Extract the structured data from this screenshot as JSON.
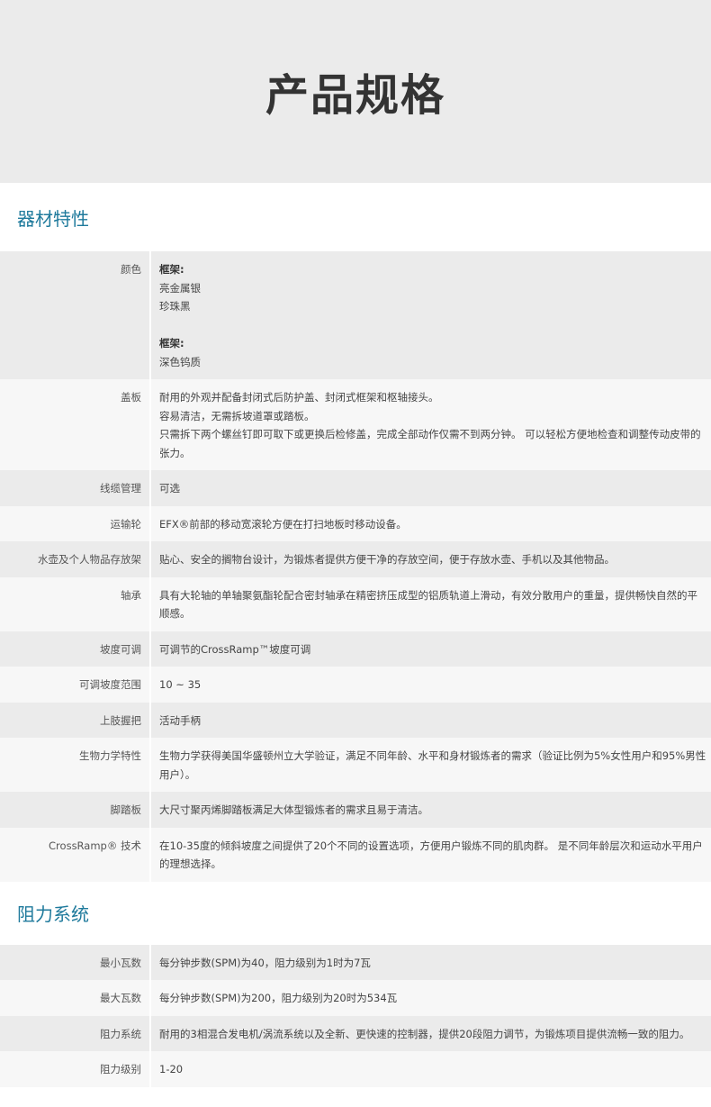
{
  "hero": {
    "title": "产品规格"
  },
  "sections": [
    {
      "title": "器材特性",
      "rows": [
        {
          "key": "颜色",
          "lines": [
            {
              "text": "框架:",
              "bold": true
            },
            {
              "text": "亮金属银"
            },
            {
              "text": "珍珠黑"
            },
            {
              "text": ""
            },
            {
              "text": "框架:",
              "bold": true
            },
            {
              "text": "深色钨质"
            }
          ]
        },
        {
          "key": "盖板",
          "lines": [
            {
              "text": "耐用的外观并配备封闭式后防护盖、封闭式框架和枢轴接头。"
            },
            {
              "text": "容易清洁，无需拆坡道罩或踏板。"
            },
            {
              "text": "只需拆下两个螺丝钉即可取下或更换后检修盖，完成全部动作仅需不到两分钟。 可以轻松方便地检查和调整传动皮带的张力。"
            }
          ]
        },
        {
          "key": "线缆管理",
          "lines": [
            {
              "text": "可选"
            }
          ]
        },
        {
          "key": "运输轮",
          "lines": [
            {
              "text": "EFX®前部的移动宽滚轮方便在打扫地板时移动设备。"
            }
          ]
        },
        {
          "key": "水壶及个人物品存放架",
          "lines": [
            {
              "text": "贴心、安全的搁物台设计，为锻炼者提供方便干净的存放空间，便于存放水壶、手机以及其他物品。"
            }
          ]
        },
        {
          "key": "轴承",
          "lines": [
            {
              "text": "具有大轮轴的单轴聚氨酯轮配合密封轴承在精密挤压成型的铝质轨道上滑动，有效分散用户的重量，提供畅快自然的平顺感。"
            }
          ]
        },
        {
          "key": "坡度可调",
          "lines": [
            {
              "text": "可调节的CrossRamp™坡度可调"
            }
          ]
        },
        {
          "key": "可调坡度范围",
          "lines": [
            {
              "text": "10 ~ 35"
            }
          ]
        },
        {
          "key": "上肢握把",
          "lines": [
            {
              "text": "活动手柄"
            }
          ]
        },
        {
          "key": "生物力学特性",
          "lines": [
            {
              "text": "生物力学获得美国华盛顿州立大学验证，满足不同年龄、水平和身材锻炼者的需求（验证比例为5%女性用户和95%男性用户）。"
            }
          ]
        },
        {
          "key": "脚踏板",
          "lines": [
            {
              "text": "大尺寸聚丙烯脚踏板满足大体型锻炼者的需求且易于清洁。"
            }
          ]
        },
        {
          "key": "CrossRamp® 技术",
          "lines": [
            {
              "text": "在10-35度的倾斜坡度之间提供了20个不同的设置选项，方便用户锻炼不同的肌肉群。 是不同年龄层次和运动水平用户的理想选择。"
            }
          ]
        }
      ]
    },
    {
      "title": "阻力系统",
      "rows": [
        {
          "key": "最小瓦数",
          "lines": [
            {
              "text": "每分钟步数(SPM)为40，阻力级别为1时为7瓦"
            }
          ]
        },
        {
          "key": "最大瓦数",
          "lines": [
            {
              "text": "每分钟步数(SPM)为200，阻力级别为20时为534瓦"
            }
          ]
        },
        {
          "key": "阻力系统",
          "lines": [
            {
              "text": "耐用的3相混合发电机/涡流系统以及全新、更快速的控制器，提供20段阻力调节，为锻炼项目提供流畅一致的阻力。"
            }
          ]
        },
        {
          "key": "阻力级别",
          "lines": [
            {
              "text": "1-20"
            }
          ]
        }
      ]
    }
  ]
}
